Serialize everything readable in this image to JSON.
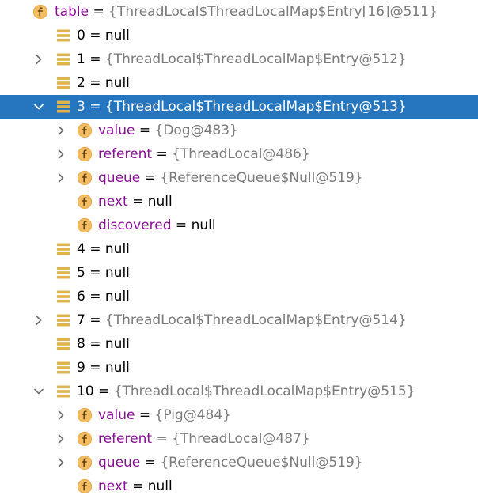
{
  "colors": {
    "selection_bg": "#2675bf",
    "field_name": "#871094",
    "value_ref": "#7a7a7a",
    "field_icon_fill": "#f4bd63",
    "array_icon": "#e0b44c"
  },
  "rows": [
    {
      "name": "table",
      "eq": " = ",
      "value": "{ThreadLocal$ThreadLocalMap$Entry[16]@511}",
      "icon": "field-icon",
      "chevron": "down",
      "depth": 0
    },
    {
      "name": "0",
      "eq": " = ",
      "value": "null",
      "icon": "array-element-icon",
      "chevron": "none",
      "depth": 1
    },
    {
      "name": "1",
      "eq": " = ",
      "value": "{ThreadLocal$ThreadLocalMap$Entry@512}",
      "icon": "array-element-icon",
      "chevron": "right",
      "depth": 1
    },
    {
      "name": "2",
      "eq": " = ",
      "value": "null",
      "icon": "array-element-icon",
      "chevron": "none",
      "depth": 1
    },
    {
      "name": "3",
      "eq": " = ",
      "value": "{ThreadLocal$ThreadLocalMap$Entry@513}",
      "icon": "array-element-icon",
      "chevron": "down",
      "depth": 1,
      "selected": true
    },
    {
      "name": "value",
      "eq": " = ",
      "value": "{Dog@483}",
      "icon": "field-icon",
      "chevron": "right",
      "depth": 2
    },
    {
      "name": "referent",
      "eq": " = ",
      "value": "{ThreadLocal@486}",
      "icon": "field-icon",
      "chevron": "right",
      "depth": 2
    },
    {
      "name": "queue",
      "eq": " = ",
      "value": "{ReferenceQueue$Null@519}",
      "icon": "field-icon",
      "chevron": "right",
      "depth": 2
    },
    {
      "name": "next",
      "eq": " = ",
      "value": "null",
      "icon": "field-icon",
      "chevron": "none",
      "depth": 2
    },
    {
      "name": "discovered",
      "eq": " = ",
      "value": "null",
      "icon": "field-icon",
      "chevron": "none",
      "depth": 2
    },
    {
      "name": "4",
      "eq": " = ",
      "value": "null",
      "icon": "array-element-icon",
      "chevron": "none",
      "depth": 1
    },
    {
      "name": "5",
      "eq": " = ",
      "value": "null",
      "icon": "array-element-icon",
      "chevron": "none",
      "depth": 1
    },
    {
      "name": "6",
      "eq": " = ",
      "value": "null",
      "icon": "array-element-icon",
      "chevron": "none",
      "depth": 1
    },
    {
      "name": "7",
      "eq": " = ",
      "value": "{ThreadLocal$ThreadLocalMap$Entry@514}",
      "icon": "array-element-icon",
      "chevron": "right",
      "depth": 1
    },
    {
      "name": "8",
      "eq": " = ",
      "value": "null",
      "icon": "array-element-icon",
      "chevron": "none",
      "depth": 1
    },
    {
      "name": "9",
      "eq": " = ",
      "value": "null",
      "icon": "array-element-icon",
      "chevron": "none",
      "depth": 1
    },
    {
      "name": "10",
      "eq": " = ",
      "value": "{ThreadLocal$ThreadLocalMap$Entry@515}",
      "icon": "array-element-icon",
      "chevron": "down",
      "depth": 1
    },
    {
      "name": "value",
      "eq": " = ",
      "value": "{Pig@484}",
      "icon": "field-icon",
      "chevron": "right",
      "depth": 2
    },
    {
      "name": "referent",
      "eq": " = ",
      "value": "{ThreadLocal@487}",
      "icon": "field-icon",
      "chevron": "right",
      "depth": 2
    },
    {
      "name": "queue",
      "eq": " = ",
      "value": "{ReferenceQueue$Null@519}",
      "icon": "field-icon",
      "chevron": "right",
      "depth": 2
    },
    {
      "name": "next",
      "eq": " = ",
      "value": "null",
      "icon": "field-icon",
      "chevron": "none",
      "depth": 2
    }
  ]
}
